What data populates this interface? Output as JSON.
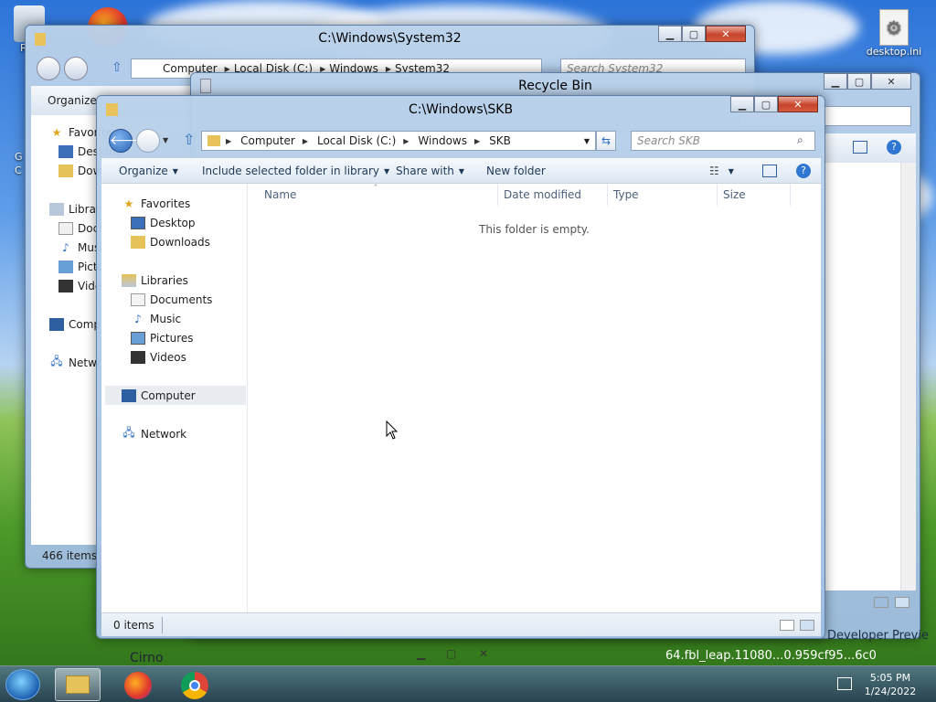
{
  "desktop": {
    "left_icon_label": "Rec",
    "right_icon_label": "desktop.ini",
    "left_edge_labels": [
      "G",
      "C"
    ]
  },
  "window_system32": {
    "title": "C:\\Windows\\System32",
    "breadcrumbs": [
      "Computer",
      "Local Disk (C:)",
      "Windows",
      "System32"
    ],
    "search_placeholder": "Search System32",
    "organize_label": "Organize",
    "nav_items": [
      "Favorites",
      "Desktop",
      "Downloads",
      "Libraries",
      "Documents",
      "Music",
      "Pictures",
      "Videos",
      "Computer",
      "Network"
    ],
    "status": "466 items"
  },
  "window_recycle": {
    "title": "Recycle Bin",
    "fragment_labels": [
      "Recycle Bin",
      "Developer Previe",
      "64.fbl_leap.11080...0.959cf95...6c0"
    ]
  },
  "window_skb": {
    "title": "C:\\Windows\\SKB",
    "breadcrumbs": [
      "Computer",
      "Local Disk (C:)",
      "Windows",
      "SKB"
    ],
    "search_placeholder": "Search SKB",
    "toolbar": {
      "organize": "Organize",
      "include": "Include selected folder in library",
      "share": "Share with",
      "new_folder": "New folder"
    },
    "nav": {
      "favorites": "Favorites",
      "desktop": "Desktop",
      "downloads": "Downloads",
      "libraries": "Libraries",
      "documents": "Documents",
      "music": "Music",
      "pictures": "Pictures",
      "videos": "Videos",
      "computer": "Computer",
      "network": "Network"
    },
    "columns": [
      "Name",
      "Date modified",
      "Type",
      "Size"
    ],
    "empty_text": "This folder is empty.",
    "status": "0 items"
  },
  "behind_window": {
    "title": "Cirno"
  },
  "taskbar": {
    "time": "5:05 PM",
    "date": "1/24/2022"
  },
  "colors": {
    "accent": "#3f7bd6",
    "close": "#c7442b"
  }
}
